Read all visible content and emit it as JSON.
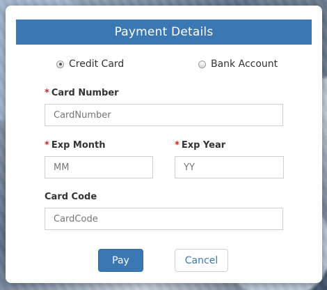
{
  "dialog": {
    "title": "Payment Details"
  },
  "payment_method": {
    "options": [
      {
        "label": "Credit Card",
        "selected": true
      },
      {
        "label": "Bank Account",
        "selected": false
      }
    ]
  },
  "form": {
    "required_marker": "*",
    "card_number": {
      "label": "Card Number",
      "placeholder": "CardNumber"
    },
    "exp_month": {
      "label": "Exp Month",
      "placeholder": "MM"
    },
    "exp_year": {
      "label": "Exp Year",
      "placeholder": "YY"
    },
    "card_code": {
      "label": "Card Code",
      "placeholder": "CardCode"
    }
  },
  "actions": {
    "pay_label": "Pay",
    "cancel_label": "Cancel"
  },
  "colors": {
    "header_bg": "#3b77b3",
    "required": "#dd2222"
  }
}
